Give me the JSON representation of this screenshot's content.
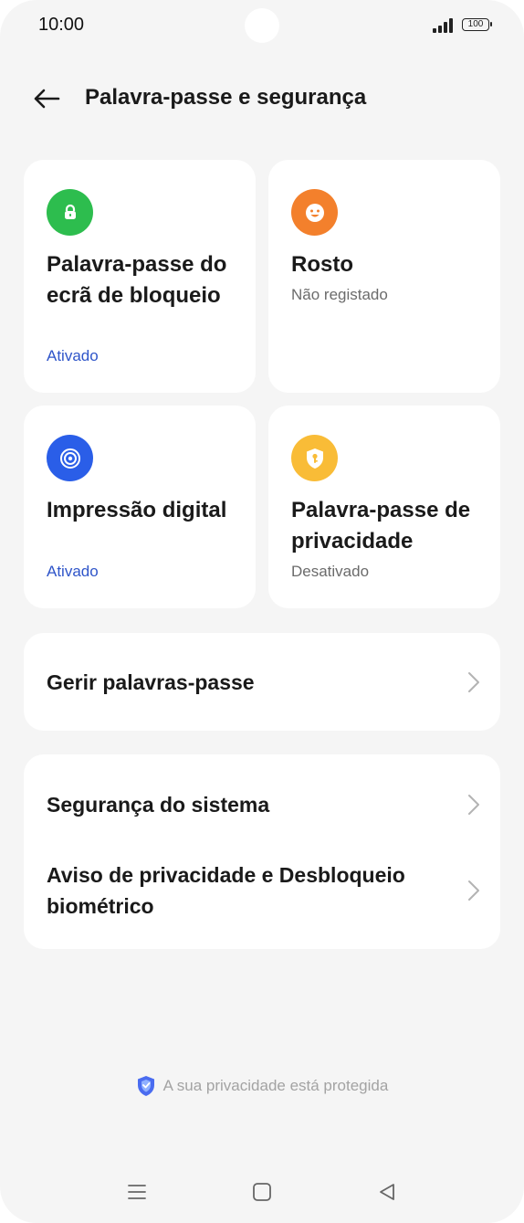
{
  "status_bar": {
    "time": "10:00",
    "battery": "100"
  },
  "header": {
    "title": "Palavra-passe e segurança"
  },
  "tiles": [
    {
      "title": "Palavra-passe do ecrã de bloqueio",
      "status": "Ativado",
      "icon": "lock-icon",
      "color": "#2dbd4e"
    },
    {
      "title": "Rosto",
      "status": "Não registado",
      "icon": "face-icon",
      "color": "#f3802c"
    },
    {
      "title": "Impressão digital",
      "status": "Ativado",
      "icon": "fingerprint-icon",
      "color": "#2a5ee8"
    },
    {
      "title": "Palavra-passe de privacidade",
      "status": "Desativado",
      "icon": "shield-key-icon",
      "color": "#f9bc37"
    }
  ],
  "manage": {
    "label": "Gerir palavras-passe"
  },
  "system": {
    "items": [
      {
        "label": "Segurança do sistema"
      },
      {
        "label": "Aviso de privacidade e Desbloqueio biométrico"
      }
    ]
  },
  "footer": {
    "privacy_note": "A sua privacidade está protegida"
  },
  "colors": {
    "accent_on": "#2f55c9",
    "background": "#f5f5f5",
    "card": "#ffffff"
  }
}
